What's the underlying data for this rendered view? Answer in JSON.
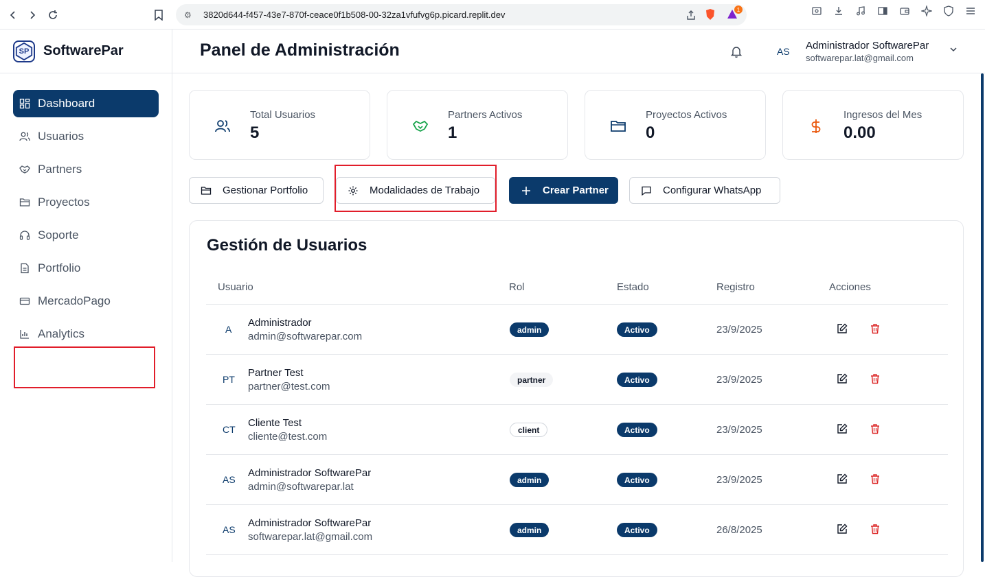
{
  "browser": {
    "url": "3820d644-f457-43e7-870f-ceace0f1b508-00-32za1vfufvg6p.picard.replit.dev",
    "notification_count": "1"
  },
  "brand": {
    "name": "SoftwarePar",
    "logo_text": "SP"
  },
  "sidebar": {
    "items": [
      {
        "label": "Dashboard",
        "icon": "dashboard-icon",
        "active": true
      },
      {
        "label": "Usuarios",
        "icon": "users-icon"
      },
      {
        "label": "Partners",
        "icon": "handshake-icon"
      },
      {
        "label": "Proyectos",
        "icon": "folder-icon"
      },
      {
        "label": "Soporte",
        "icon": "headset-icon"
      },
      {
        "label": "Portfolio",
        "icon": "document-icon"
      },
      {
        "label": "MercadoPago",
        "icon": "credit-card-icon"
      },
      {
        "label": "Analytics",
        "icon": "bar-chart-icon"
      }
    ]
  },
  "header": {
    "title": "Panel de Administración",
    "user_initials": "AS",
    "user_name": "Administrador SoftwarePar",
    "user_email": "softwarepar.lat@gmail.com"
  },
  "stats": [
    {
      "label": "Total Usuarios",
      "value": "5",
      "icon": "users-icon",
      "color": "#0b3a6b"
    },
    {
      "label": "Partners Activos",
      "value": "1",
      "icon": "handshake-icon",
      "color": "#16a34a"
    },
    {
      "label": "Proyectos Activos",
      "value": "0",
      "icon": "folder-icon",
      "color": "#0b3a6b"
    },
    {
      "label": "Ingresos del Mes",
      "value": "0.00",
      "icon": "dollar-icon",
      "color": "#ea580c"
    }
  ],
  "actions": {
    "portfolio": "Gestionar Portfolio",
    "modalidades": "Modalidades de Trabajo",
    "crear_partner": "Crear Partner",
    "whatsapp": "Configurar WhatsApp"
  },
  "users_table": {
    "title": "Gestión de Usuarios",
    "columns": [
      "Usuario",
      "Rol",
      "Estado",
      "Registro",
      "Acciones"
    ],
    "rows": [
      {
        "initials": "A",
        "name": "Administrador",
        "email": "admin@softwarepar.com",
        "role": "admin",
        "status": "Activo",
        "date": "23/9/2025"
      },
      {
        "initials": "PT",
        "name": "Partner Test",
        "email": "partner@test.com",
        "role": "partner",
        "status": "Activo",
        "date": "23/9/2025"
      },
      {
        "initials": "CT",
        "name": "Cliente Test",
        "email": "cliente@test.com",
        "role": "client",
        "status": "Activo",
        "date": "23/9/2025"
      },
      {
        "initials": "AS",
        "name": "Administrador SoftwarePar",
        "email": "admin@softwarepar.lat",
        "role": "admin",
        "status": "Activo",
        "date": "23/9/2025"
      },
      {
        "initials": "AS",
        "name": "Administrador SoftwarePar",
        "email": "softwarepar.lat@gmail.com",
        "role": "admin",
        "status": "Activo",
        "date": "26/8/2025"
      }
    ]
  }
}
